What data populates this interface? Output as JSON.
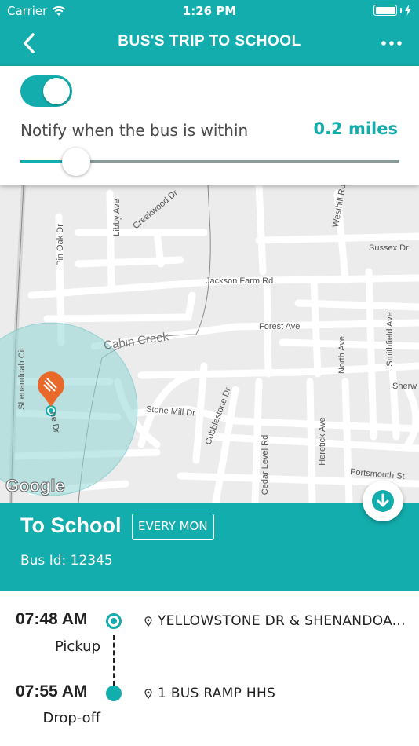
{
  "status_bar": {
    "carrier": "Carrier",
    "time": "1:26 PM"
  },
  "nav": {
    "title": "BUS'S TRIP TO SCHOOL",
    "back_icon": "chevron-left-icon",
    "more_icon": "more-dots-icon"
  },
  "notify": {
    "enabled": true,
    "label": "Notify when the bus is within",
    "value_text": "0.2 miles",
    "slider_fraction": 0.11
  },
  "map": {
    "streets": [
      "Libby Ave",
      "Creekwood Dr",
      "Westhill Rd",
      "Pin Oak Dr",
      "Sussex Dr",
      "Jackson Farm Rd",
      "Forest Ave",
      "Cabin Creek",
      "Smithfield Ave",
      "North Ave",
      "Shenandoah Cir",
      "Stone Mill Dr",
      "Cobblestone Dr",
      "Sherw",
      "Cedar Level Rd",
      "Heretick Ave",
      "Portsmouth St",
      "ne Dr"
    ],
    "logo": "Google",
    "accent": "#13adad",
    "marker_color": "#e8692a"
  },
  "trip": {
    "title": "To School",
    "badge": "EVERY MON",
    "bus_id": "Bus Id: 12345"
  },
  "stops": [
    {
      "time": "07:48 AM",
      "type": "Pickup",
      "address": "YELLOWSTONE DR & SHENANDOA..."
    },
    {
      "time": "07:55 AM",
      "type": "Drop-off",
      "address": "1 BUS RAMP HHS"
    }
  ]
}
